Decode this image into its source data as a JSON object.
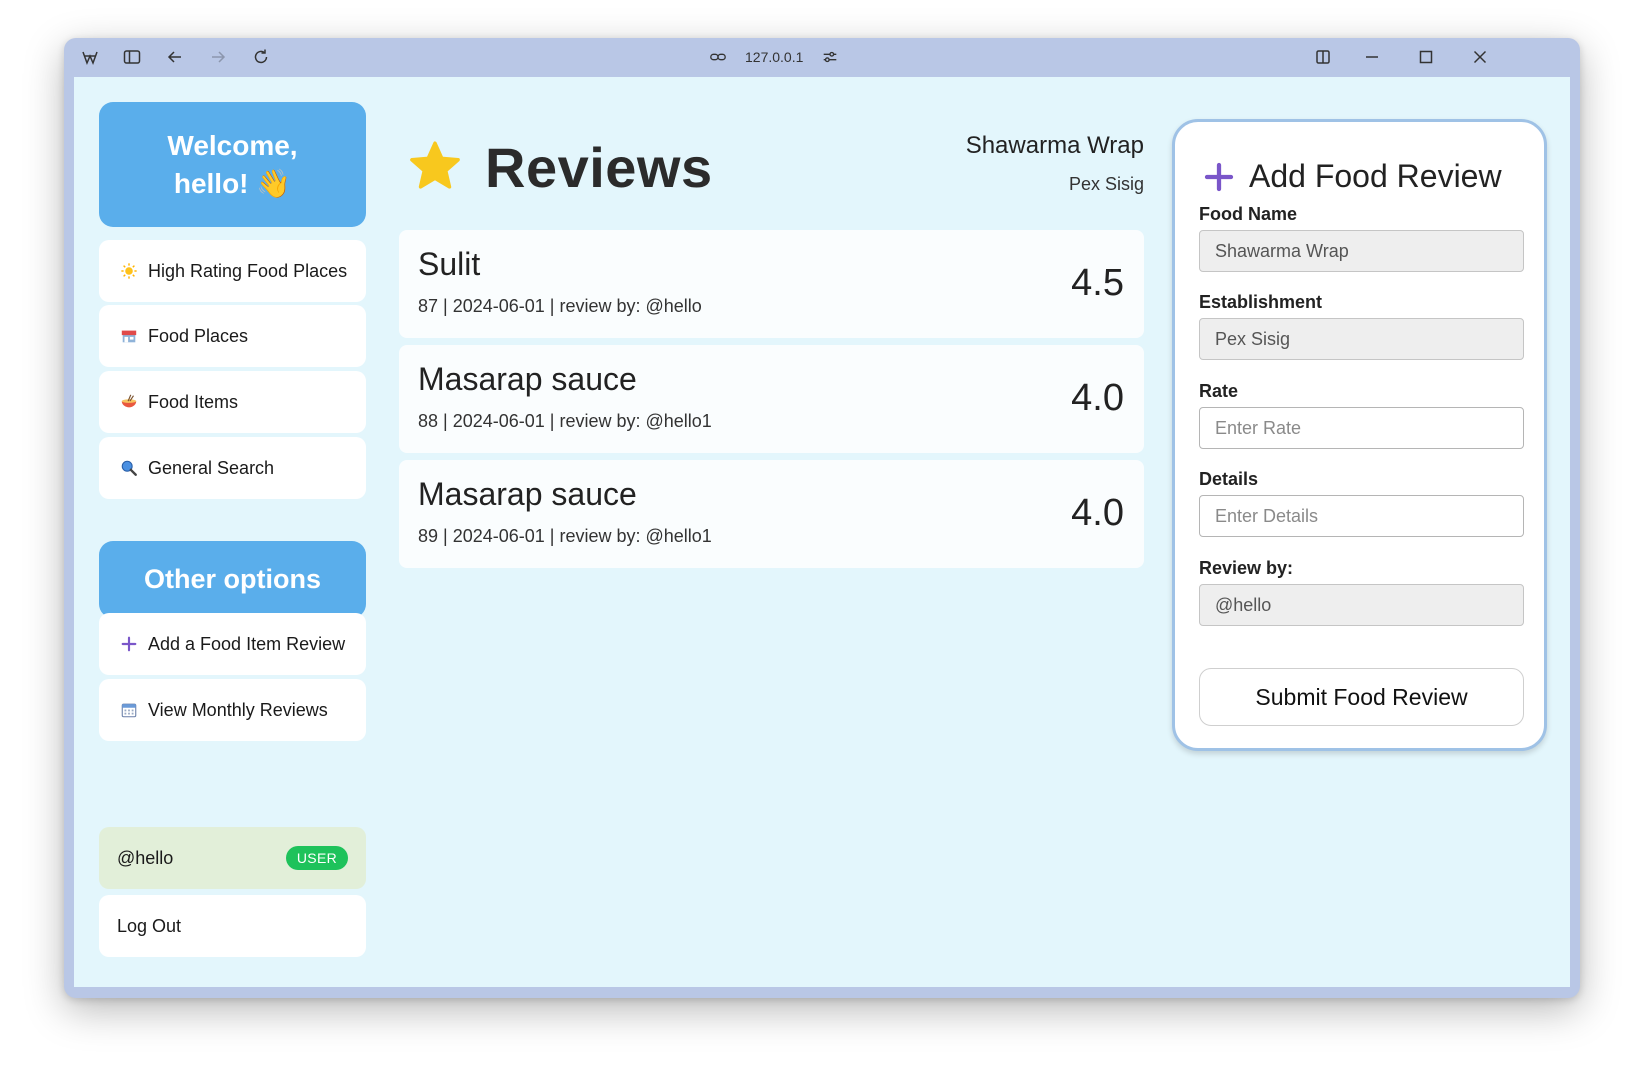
{
  "browser": {
    "address": "127.0.0.1"
  },
  "sidebar": {
    "welcome_line1": "Welcome,",
    "welcome_line2": "hello! 👋",
    "nav": [
      {
        "label": "High Rating Food Places",
        "icon": "sun-icon"
      },
      {
        "label": "Food Places",
        "icon": "store-icon"
      },
      {
        "label": "Food Items",
        "icon": "noodle-bowl-icon"
      },
      {
        "label": "General Search",
        "icon": "search-icon"
      }
    ],
    "other_heading": "Other options",
    "other": [
      {
        "label": "Add a Food Item Review",
        "icon": "plus-icon"
      },
      {
        "label": "View Monthly Reviews",
        "icon": "calendar-icon"
      }
    ],
    "user": {
      "handle": "@hello",
      "badge": "USER"
    },
    "logout_label": "Log Out"
  },
  "main": {
    "title": "Reviews",
    "selected_food": "Shawarma Wrap",
    "selected_establishment": "Pex Sisig",
    "reviews": [
      {
        "name": "Sulit",
        "meta": "87 | 2024-06-01 | review by: @hello",
        "rating": "4.5"
      },
      {
        "name": "Masarap sauce",
        "meta": "88 | 2024-06-01 | review by: @hello1",
        "rating": "4.0"
      },
      {
        "name": "Masarap sauce",
        "meta": "89 | 2024-06-01 | review by: @hello1",
        "rating": "4.0"
      }
    ]
  },
  "form": {
    "title": "Add Food Review",
    "food_name_label": "Food Name",
    "food_name_value": "Shawarma Wrap",
    "establishment_label": "Establishment",
    "establishment_value": "Pex Sisig",
    "rate_label": "Rate",
    "rate_placeholder": "Enter Rate",
    "details_label": "Details",
    "details_placeholder": "Enter Details",
    "review_by_label": "Review by:",
    "review_by_value": "@hello",
    "submit_label": "Submit Food Review"
  },
  "colors": {
    "page_bg": "#e3f6fc",
    "accent_blue": "#5aaeeb",
    "user_badge": "#1ec25b",
    "plus_purple": "#7a56c9",
    "star_yellow": "#f8c81e"
  }
}
